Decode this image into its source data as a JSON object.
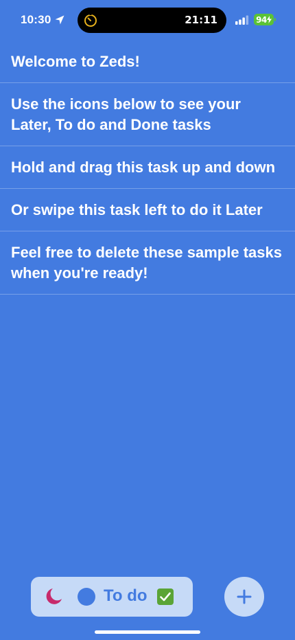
{
  "status_bar": {
    "time": "10:30",
    "island_time": "21:11",
    "battery_level": "94",
    "location_icon": "location-arrow-icon",
    "signal_icon": "cellular-signal-icon",
    "timer_icon": "timer-icon",
    "battery_charging_icon": "charging-bolt-icon",
    "battery_color": "#5bc236"
  },
  "tasks": [
    {
      "text": "Welcome to Zeds!"
    },
    {
      "text": "Use the icons below to see your Later, To do and Done tasks"
    },
    {
      "text": "Hold and drag this task up and down"
    },
    {
      "text": "Or swipe this task left to do it Later"
    },
    {
      "text": "Feel free to delete these sample tasks when you're ready!"
    }
  ],
  "tab_bar": {
    "later_icon": "crescent-moon-icon",
    "todo_icon": "blue-circle-icon",
    "active_label": "To do",
    "done_icon": "checkmark-box-icon"
  },
  "add_button": {
    "icon": "plus-icon"
  },
  "colors": {
    "background": "#437be0",
    "tab_bar_bg": "#c6daf7",
    "accent": "#437be0",
    "moon": "#c72a6b",
    "done_green": "#5aa436"
  }
}
